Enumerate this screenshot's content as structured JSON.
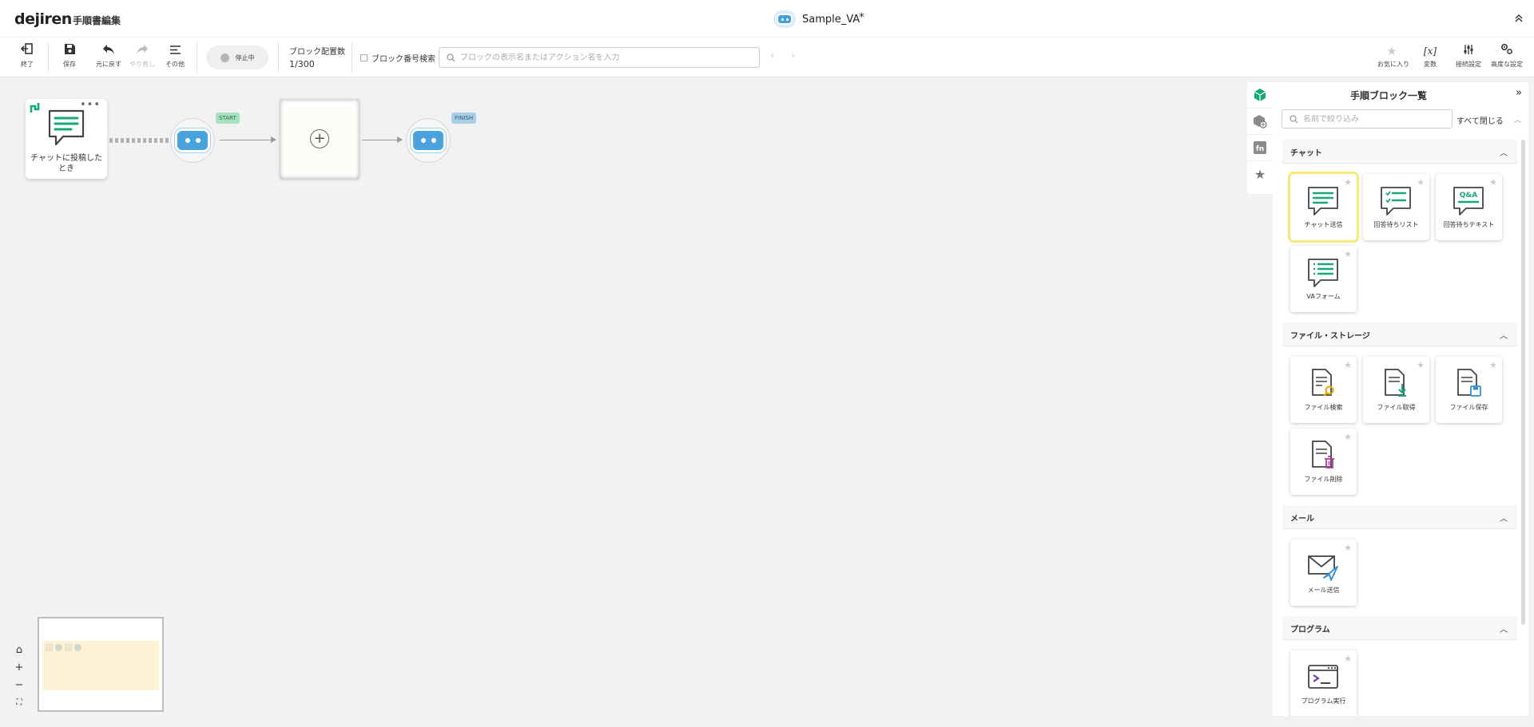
{
  "header": {
    "logo": "dejiren",
    "page_title": "手順書編集",
    "va_name": "Sample_VA",
    "unsaved_mark": "*",
    "collapse_icon": "chevron-double-up"
  },
  "toolbar": {
    "exit_label": "終了",
    "save_label": "保存",
    "undo_label": "元に戻す",
    "redo_label": "やり直し",
    "more_label": "その他",
    "status_label": "停止中",
    "block_count_label": "ブロック配置数",
    "block_count_value": "1/300",
    "block_number_search_label": "ブロック番号検索",
    "search_placeholder": "ブロックの表示名またはアクション名を入力",
    "prev_arrow": "‹",
    "next_arrow": "›",
    "favorites_label": "お気に入り",
    "variables_label": "変数",
    "variables_icon_text": "[x]",
    "connection_label": "接続設定",
    "advanced_label": "高度な設定"
  },
  "canvas": {
    "trigger_label": "チャットに投稿したとき",
    "trigger_more": "•••",
    "start_tag": "START",
    "finish_tag": "FINISH",
    "add_symbol": "+"
  },
  "zoom": {
    "home": "⌂",
    "zoom_in": "+",
    "zoom_out": "−",
    "fit": "⛶"
  },
  "panel": {
    "title": "手順ブロック一覧",
    "collapse": "»",
    "filter_placeholder": "名前で絞り込み",
    "close_all": "すべて閉じる",
    "sections": [
      {
        "title": "チャット",
        "items": [
          {
            "label": "チャット送信",
            "icon": "chat-send-icon"
          },
          {
            "label": "回答待ちリスト",
            "icon": "answer-list-icon"
          },
          {
            "label": "回答待ちテキスト",
            "icon": "qa-text-icon"
          },
          {
            "label": "VAフォーム",
            "icon": "va-form-icon"
          }
        ]
      },
      {
        "title": "ファイル・ストレージ",
        "items": [
          {
            "label": "ファイル検索",
            "icon": "file-search-icon"
          },
          {
            "label": "ファイル取得",
            "icon": "file-download-icon"
          },
          {
            "label": "ファイル保存",
            "icon": "file-save-icon"
          },
          {
            "label": "ファイル削除",
            "icon": "file-delete-icon"
          }
        ]
      },
      {
        "title": "メール",
        "items": [
          {
            "label": "メール送信",
            "icon": "mail-send-icon"
          }
        ]
      },
      {
        "title": "プログラム",
        "items": [
          {
            "label": "プログラム実行",
            "icon": "program-run-icon"
          }
        ]
      }
    ]
  },
  "colors": {
    "accent_green": "#18a77a",
    "robot_blue": "#4aa3dc",
    "start_tag": "#a7e3c1",
    "finish_tag": "#a9cfe4",
    "selected_tile": "#f7e87a"
  }
}
